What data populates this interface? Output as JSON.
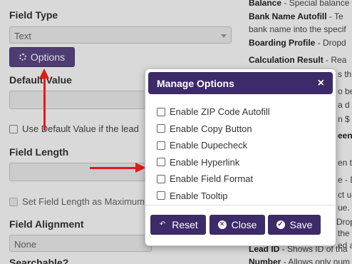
{
  "form": {
    "field_type_label": "Field Type",
    "field_type_value": "Text",
    "options_button": "Options",
    "default_value_label": "Default Value",
    "use_default_label": "Use Default Value if the lead",
    "field_length_label": "Field Length",
    "set_length_label": "Set Field Length as Maximum",
    "field_alignment_label": "Field Alignment",
    "field_alignment_value": "None",
    "searchable_label": "Searchable?"
  },
  "right_column": [
    {
      "bold": "Balance",
      "text": " - Special balance"
    },
    {
      "bold": "Bank Name Autofill",
      "text": " - Te"
    },
    {
      "bold": "",
      "text": "bank name into the specif"
    },
    {
      "bold": "Boarding Profile",
      "text": " - Dropd"
    },
    {
      "bold": "Calculation Result",
      "text": " - Rea"
    },
    {
      "bold": "",
      "text": "s th"
    },
    {
      "bold": "",
      "text": "o be"
    },
    {
      "bold": "",
      "text": "a d"
    },
    {
      "bold": "",
      "text": "n $ b"
    },
    {
      "bold": "een",
      "text": ""
    },
    {
      "bold": "",
      "text": "en to"
    },
    {
      "bold": "",
      "text": "e - D"
    },
    {
      "bold": "",
      "text": "ct us"
    },
    {
      "bold": "",
      "text": "ue."
    },
    {
      "bold": "",
      "text": "Drop"
    },
    {
      "bold": "",
      "text": "the"
    },
    {
      "bold": "",
      "text": "ed a"
    },
    {
      "bold": "Lead ID",
      "text": " - Shows ID of tha"
    },
    {
      "bold": "Number",
      "text": " - Allows only num"
    }
  ],
  "modal": {
    "title": "Manage Options",
    "close_icon": "×",
    "options": [
      {
        "label": "Enable ZIP Code Autofill",
        "checked": false
      },
      {
        "label": "Enable Copy Button",
        "checked": false
      },
      {
        "label": "Enable Dupecheck",
        "checked": false
      },
      {
        "label": "Enable Hyperlink",
        "checked": false
      },
      {
        "label": "Enable Field Format",
        "checked": false
      },
      {
        "label": "Enable Tooltip",
        "checked": false
      }
    ],
    "reset_label": "Reset",
    "close_label": "Close",
    "save_label": "Save"
  },
  "colors": {
    "accent": "#3d2a68",
    "options_button": "#5a4886",
    "arrow": "#e01b1b"
  },
  "icons": {
    "options_button": "gear-icon",
    "reset": "undo-icon",
    "close": "close-circle-icon",
    "save": "check-circle-icon"
  }
}
